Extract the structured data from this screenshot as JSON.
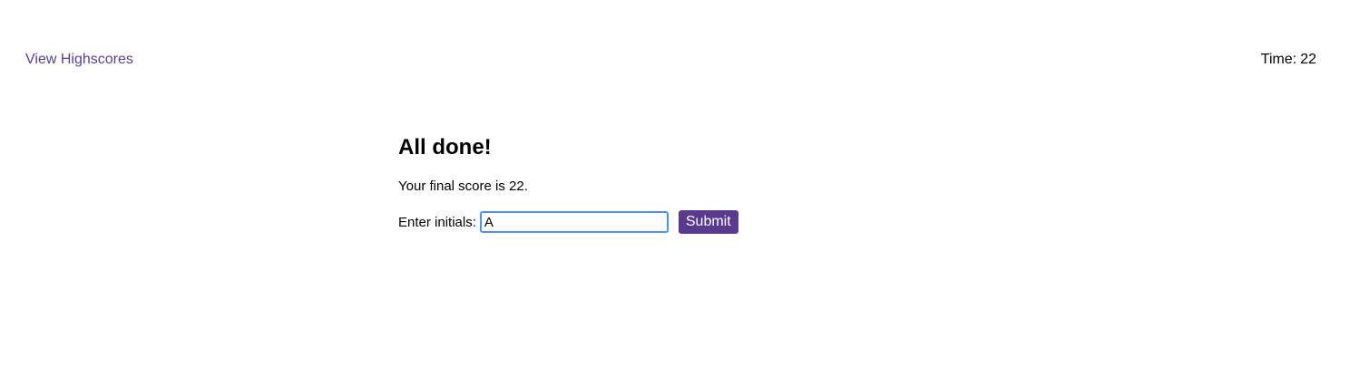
{
  "header": {
    "highscores_link": "View Highscores",
    "timer_label": "Time:",
    "timer_value": "22"
  },
  "result": {
    "title": "All done!",
    "score_text": "Your final score is 22.",
    "initials_label": "Enter initials:",
    "initials_value": "A",
    "submit_label": "Submit"
  },
  "colors": {
    "link": "#5a3f8f",
    "button_bg": "#5a3a8c",
    "input_focus_border": "#4d90fe"
  }
}
